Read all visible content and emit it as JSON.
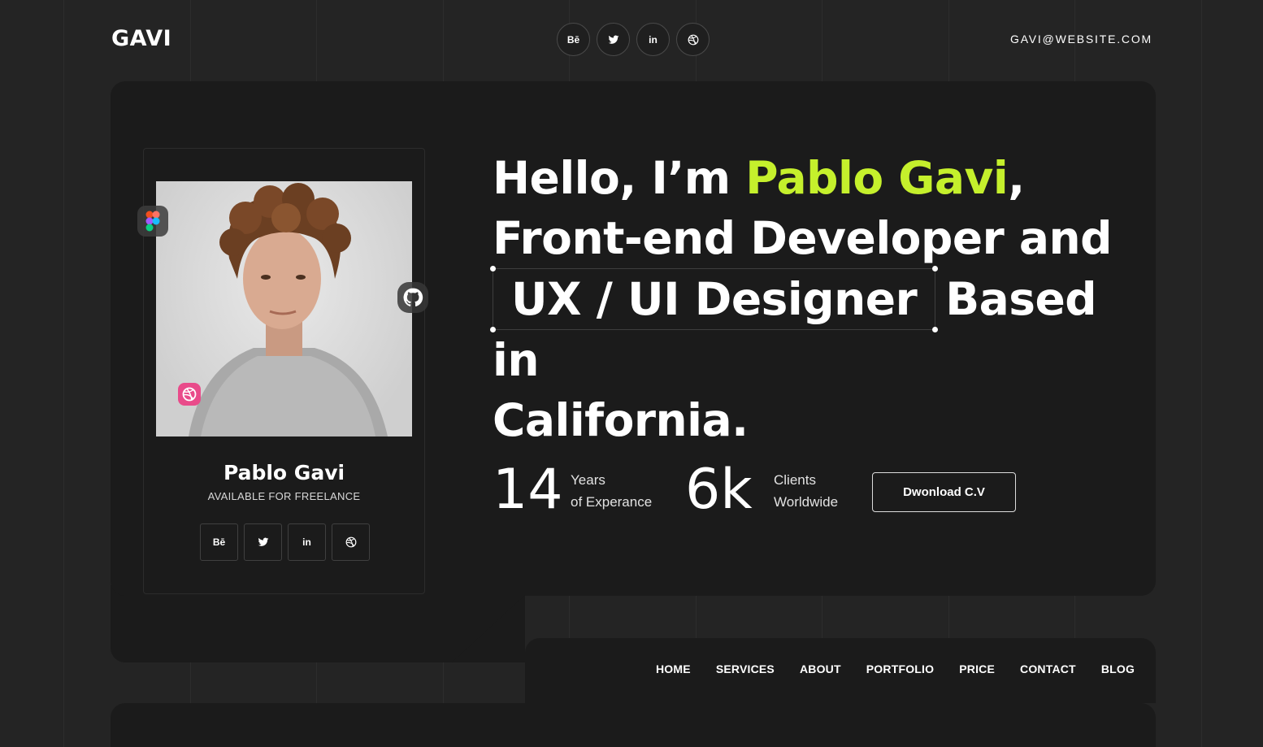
{
  "header": {
    "logo": "GAVI",
    "email": "GAVI@WEBSITE.COM",
    "social": [
      {
        "label": "Bē",
        "icon": "behance-icon"
      },
      {
        "label": "",
        "icon": "twitter-icon"
      },
      {
        "label": "in",
        "icon": "linkedin-icon"
      },
      {
        "label": "",
        "icon": "dribbble-icon"
      }
    ]
  },
  "profile": {
    "name": "Pablo Gavi",
    "subtitle": "AVAILABLE FOR FREELANCE",
    "social": [
      {
        "label": "Bē",
        "icon": "behance-icon"
      },
      {
        "label": "",
        "icon": "twitter-icon"
      },
      {
        "label": "in",
        "icon": "linkedin-icon"
      },
      {
        "label": "",
        "icon": "dribbble-icon"
      }
    ]
  },
  "headline": {
    "part1": "Hello, I’m ",
    "name": "Pablo Gavi",
    "part2": ",",
    "line2": "Front-end Developer and",
    "boxed": "UX / UI Designer",
    "part3": "Based in",
    "line4": "California."
  },
  "stats": [
    {
      "value": "14",
      "line1": "Years",
      "line2": "of Experance"
    },
    {
      "value": "6k",
      "line1": "Clients",
      "line2": "Worldwide"
    }
  ],
  "cta": {
    "download_label": "Dwonload C.V"
  },
  "nav": [
    "HOME",
    "SERVICES",
    "ABOUT",
    "PORTFOLIO",
    "PRICE",
    "CONTACT",
    "BLOG"
  ],
  "colors": {
    "accent": "#c5f02c",
    "background": "#242424",
    "panel": "#1b1b1b"
  }
}
